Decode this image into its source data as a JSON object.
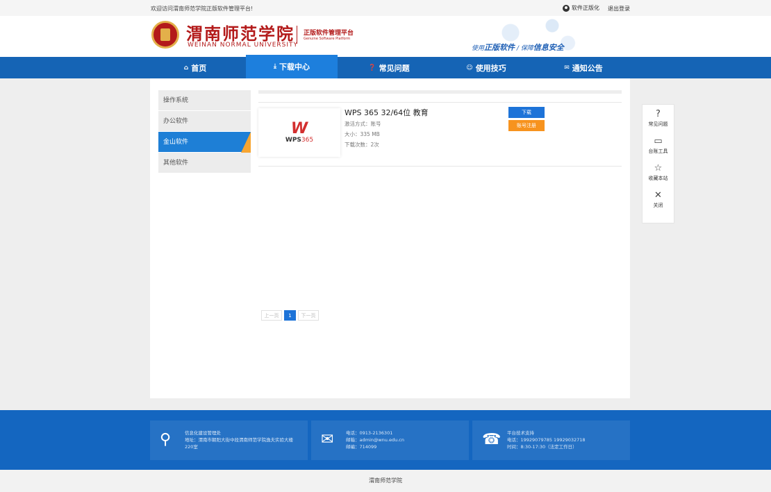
{
  "topbar": {
    "welcome": "欢迎访问渭南师范学院正版软件管理平台!",
    "user_name": "软件正版化",
    "logout": "退出登录"
  },
  "header": {
    "school_cn": "渭南师范学院",
    "school_en": "WEINAN NORMAL UNIVERSITY",
    "platform_cn": "正版软件管理平台",
    "platform_en": "Genuine Software Platform",
    "slogan_a": "使用",
    "slogan_b": "正版软件",
    "slogan_c": " / 保障",
    "slogan_d": "信息安全"
  },
  "nav": [
    {
      "label": "首页",
      "icon": "home-icon",
      "glyph": "⌂"
    },
    {
      "label": "下载中心",
      "icon": "download-icon",
      "glyph": "⤓"
    },
    {
      "label": "常见问题",
      "icon": "question-icon",
      "glyph": "❓"
    },
    {
      "label": "使用技巧",
      "icon": "tips-icon",
      "glyph": "☺"
    },
    {
      "label": "通知公告",
      "icon": "notice-icon",
      "glyph": "✉"
    }
  ],
  "sidemenu": [
    "操作系统",
    "办公软件",
    "金山软件",
    "其他软件"
  ],
  "software": {
    "title": "WPS 365 32/64位 教育",
    "activation": "激活方式：账号",
    "size": "大小：335 MB",
    "downloads": "下载次数：2次",
    "download_btn": "下载",
    "register_btn": "账号注册",
    "logo_mark": "W",
    "logo_text_a": "WPS",
    "logo_text_b": "365"
  },
  "pager": {
    "prev": "上一页",
    "current": "1",
    "next": "下一页"
  },
  "floatbar": [
    {
      "label": "常见问题",
      "icon": "help-circle-icon",
      "glyph": "?"
    },
    {
      "label": "台账工具",
      "icon": "monitor-icon",
      "glyph": "▭"
    },
    {
      "label": "收藏本站",
      "icon": "star-icon",
      "glyph": "☆"
    },
    {
      "label": "关闭",
      "icon": "close-icon",
      "glyph": "✕"
    }
  ],
  "footer": {
    "box1": {
      "title": "信息化建设管理处",
      "line1": "地址：渭南市朝阳大街中段渭南师范学院逸夫实验大楼",
      "line2": "220室"
    },
    "box2": {
      "line1": "电话：0913-2136301",
      "line2": "邮箱：admin@wnu.edu.cn",
      "line3": "邮编：714099"
    },
    "box3": {
      "title": "平台技术支持",
      "line1": "电话：19929079785 19929032718",
      "line2": "时间：8:30-17:30（法定工作日）"
    }
  },
  "bottom": "渭南师范学院",
  "colors": {
    "nav_bg": "#1564b5",
    "active": "#1d7fdd",
    "accent_orange": "#f7931e",
    "brand_red": "#b31a1a"
  }
}
